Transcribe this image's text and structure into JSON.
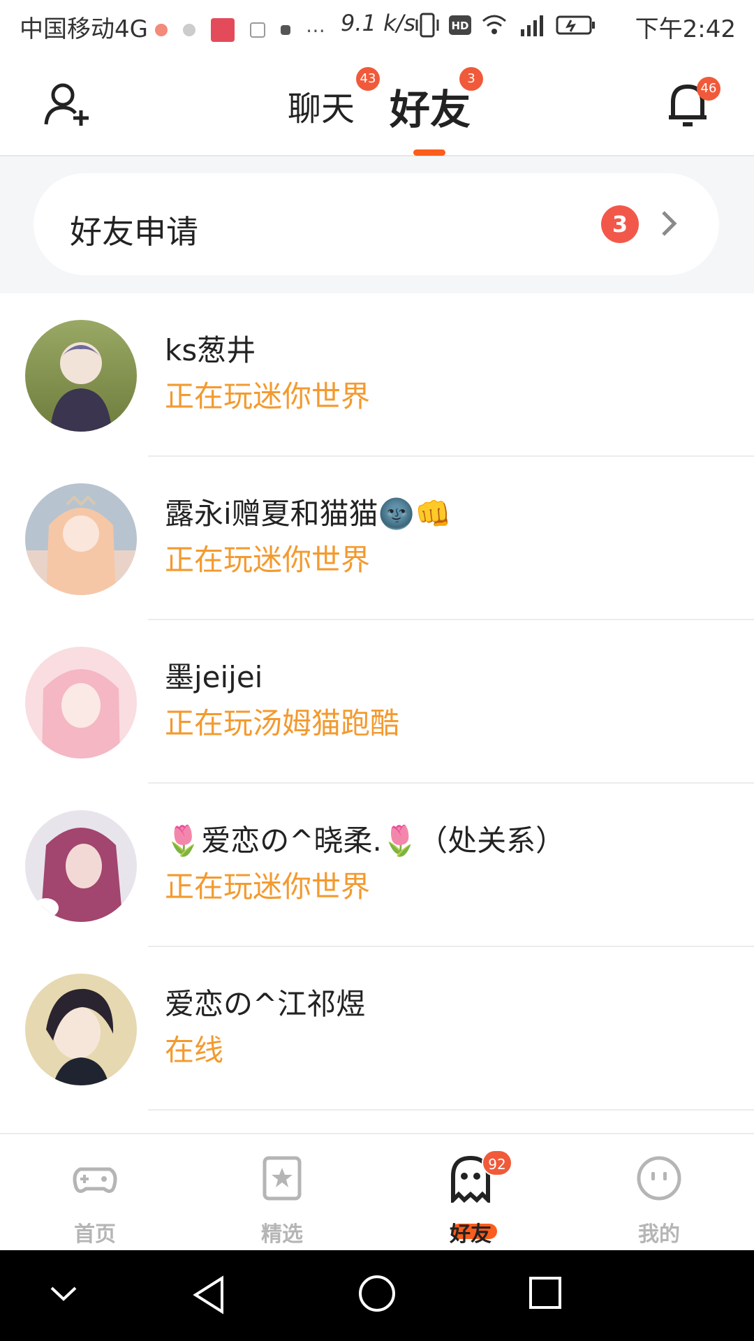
{
  "status_bar": {
    "carrier": "中国移动4G",
    "network_speed": "9.1 k/s",
    "time": "下午2:42",
    "icons": [
      "notification-icons",
      "vibrate-icon",
      "hd-icon",
      "wifi-icon",
      "signal-icon",
      "battery-icon"
    ]
  },
  "header": {
    "tabs": [
      {
        "label": "聊天",
        "badge": "43",
        "active": false
      },
      {
        "label": "好友",
        "badge": "3",
        "active": true
      }
    ],
    "add_friend_icon": "add-user-icon",
    "bell_badge": "46",
    "accent_color": "#fb5d1c"
  },
  "friend_requests": {
    "label": "好友申请",
    "count": "3"
  },
  "friends": [
    {
      "name": "ks葱井",
      "status": "正在玩迷你世界",
      "avatar_colors": [
        "#7d8a4a",
        "#3b3550"
      ]
    },
    {
      "name": "露永i赠夏和猫猫🌚👊",
      "status": "正在玩迷你世界",
      "avatar_colors": [
        "#f6c7a6",
        "#b7c4cf"
      ]
    },
    {
      "name": "墨jeijei",
      "status": "正在玩汤姆猫跑酷",
      "avatar_colors": [
        "#f4b7c3",
        "#f9dde1"
      ]
    },
    {
      "name": "🌷爱恋の^晓柔.🌷（处关系）",
      "status": "正在玩迷你世界",
      "avatar_colors": [
        "#a2456f",
        "#e8b6c4"
      ]
    },
    {
      "name": "爱恋の^江祁煜",
      "status": "在线",
      "avatar_colors": [
        "#2a2430",
        "#e6d8b0"
      ]
    }
  ],
  "bottom_nav": {
    "items": [
      {
        "label": "首页",
        "icon": "gamepad-icon",
        "active": false
      },
      {
        "label": "精选",
        "icon": "star-bookmark-icon",
        "active": false
      },
      {
        "label": "好友",
        "icon": "ghost-icon",
        "active": true,
        "badge": "92"
      },
      {
        "label": "我的",
        "icon": "smiley-icon",
        "active": false
      }
    ]
  },
  "colors": {
    "status_text": "#f39a2f",
    "badge": "#f05a3a"
  }
}
